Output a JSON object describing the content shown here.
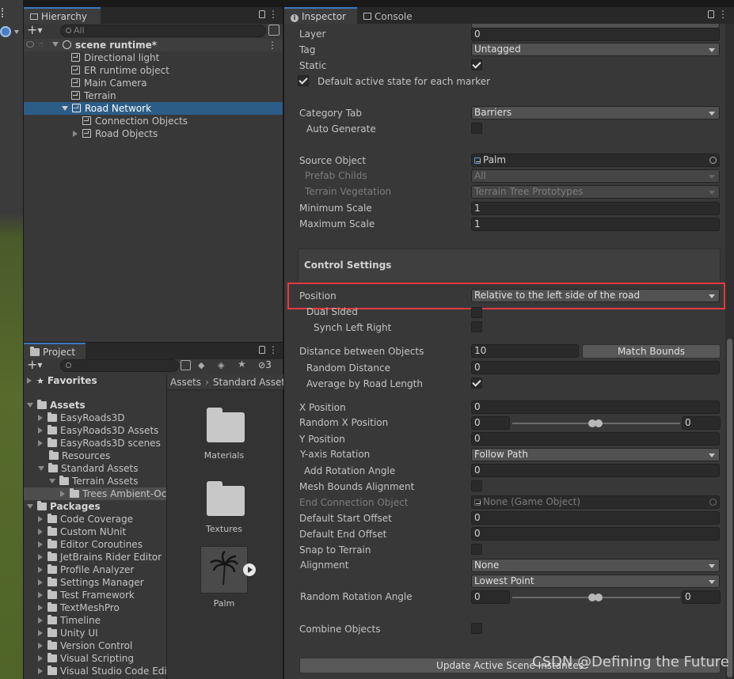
{
  "hierarchy": {
    "tab_label": "Hierarchy",
    "search_placeholder": "All",
    "scene_name": "scene runtime*",
    "items": [
      {
        "label": "Directional light"
      },
      {
        "label": "ER runtime object"
      },
      {
        "label": "Main Camera"
      },
      {
        "label": "Terrain"
      },
      {
        "label": "Road Network"
      },
      {
        "label": "Connection Objects"
      },
      {
        "label": "Road Objects"
      }
    ]
  },
  "project": {
    "tab_label": "Project",
    "hidden_count": "3",
    "favorites_label": "Favorites",
    "assets_label": "Assets",
    "asset_folders": [
      "EasyRoads3D",
      "EasyRoads3D Assets",
      "EasyRoads3D scenes",
      "Resources",
      "Standard Assets"
    ],
    "terrain_assets_label": "Terrain Assets",
    "trees_label": "Trees Ambient-Oc",
    "packages_label": "Packages",
    "packages": [
      "Code Coverage",
      "Custom NUnit",
      "Editor Coroutines",
      "JetBrains Rider Editor",
      "Profile Analyzer",
      "Settings Manager",
      "Test Framework",
      "TextMeshPro",
      "Timeline",
      "Unity UI",
      "Version Control",
      "Visual Scripting",
      "Visual Studio Code Edit"
    ],
    "breadcrumb": [
      "Assets",
      "Standard Assets"
    ],
    "grid_items": [
      {
        "label": "Materials"
      },
      {
        "label": "Textures"
      },
      {
        "label": "Palm"
      }
    ]
  },
  "inspector": {
    "tab_inspector": "Inspector",
    "tab_console": "Console",
    "layer": {
      "label": "Layer",
      "value": "0"
    },
    "tag": {
      "label": "Tag",
      "value": "Untagged"
    },
    "static": {
      "label": "Static",
      "checked": true
    },
    "default_active": {
      "label": "Default active state for each marker",
      "checked": true
    },
    "category_tab": {
      "label": "Category Tab",
      "value": "Barriers"
    },
    "auto_generate": {
      "label": "Auto Generate",
      "checked": false
    },
    "source_object": {
      "label": "Source Object",
      "value": "Palm"
    },
    "prefab_childs": {
      "label": "Prefab Childs",
      "value": "All"
    },
    "terrain_vegetation": {
      "label": "Terrain Vegetation",
      "value": "Terrain Tree Prototypes"
    },
    "minimum_scale": {
      "label": "Minimum Scale",
      "value": "1"
    },
    "maximum_scale": {
      "label": "Maximum Scale",
      "value": "1"
    },
    "control_settings": "Control Settings",
    "position": {
      "label": "Position",
      "value": "Relative to the left side of the road"
    },
    "dual_sided": {
      "label": "Dual Sided",
      "checked": false
    },
    "synch_left_right": {
      "label": "Synch Left Right",
      "checked": false
    },
    "distance_between": {
      "label": "Distance between Objects",
      "value": "10",
      "button": "Match Bounds"
    },
    "random_distance": {
      "label": "Random Distance",
      "value": "0"
    },
    "average_by_road": {
      "label": "Average by Road Length",
      "checked": true
    },
    "x_position": {
      "label": "X Position",
      "value": "0"
    },
    "random_x_position": {
      "label": "Random X Position",
      "min": "0",
      "max": "0"
    },
    "y_position": {
      "label": "Y Position",
      "value": "0"
    },
    "y_axis_rotation": {
      "label": "Y-axis Rotation",
      "value": "Follow Path"
    },
    "add_rotation_angle": {
      "label": "Add Rotation Angle",
      "value": "0"
    },
    "mesh_bounds_alignment": {
      "label": "Mesh Bounds Alignment",
      "checked": false
    },
    "end_connection_object": {
      "label": "End Connection Object",
      "value": "None (Game Object)"
    },
    "default_start_offset": {
      "label": "Default Start Offset",
      "value": "0"
    },
    "default_end_offset": {
      "label": "Default End Offset",
      "value": "0"
    },
    "snap_to_terrain": {
      "label": "Snap to Terrain",
      "checked": false
    },
    "alignment": {
      "label": "Alignment",
      "value": "None",
      "value2": "Lowest Point"
    },
    "random_rotation_angle": {
      "label": "Random Rotation Angle",
      "min": "0",
      "max": "0"
    },
    "combine_objects": {
      "label": "Combine Objects",
      "checked": false
    },
    "update_button": "Update Active Scene Instances"
  },
  "watermark": "CSDN @Defining the Future",
  "colors": {
    "highlight": "#e5393f",
    "selection": "#2c5d87",
    "accent": "#3a79bb"
  }
}
